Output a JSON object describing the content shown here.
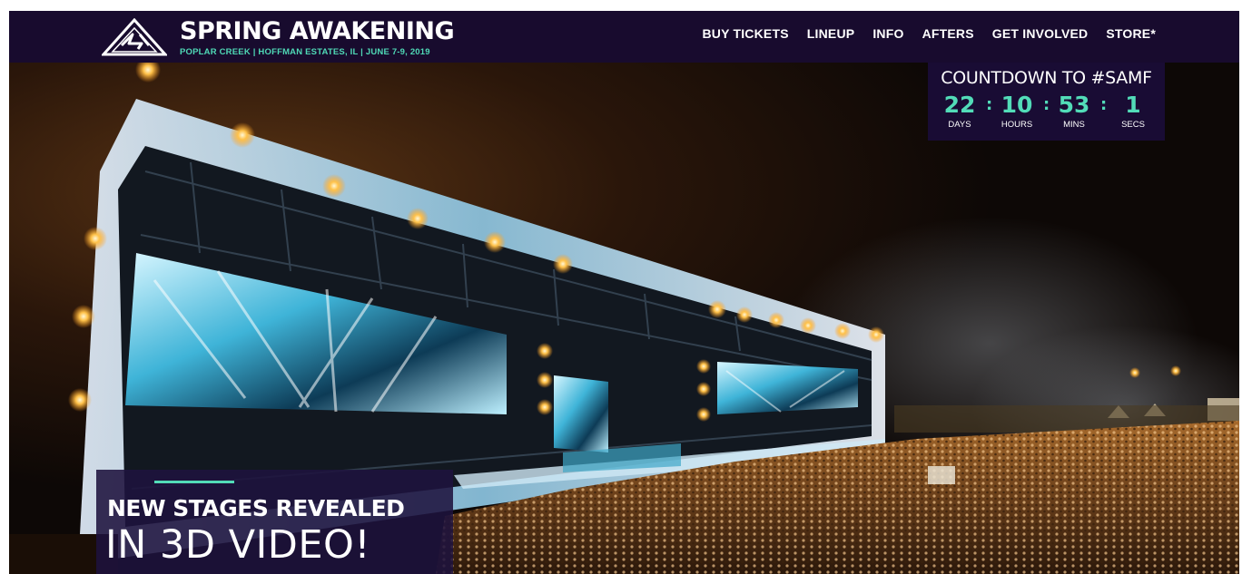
{
  "header": {
    "brand_title": "SPRING AWAKENING",
    "brand_subtitle": "POPLAR CREEK | HOFFMAN ESTATES, IL | JUNE 7-9, 2019",
    "logo_icon": "sa-triangle-logo-icon"
  },
  "nav": {
    "items": [
      "BUY TICKETS",
      "LINEUP",
      "INFO",
      "AFTERS",
      "GET INVOLVED",
      "STORE*"
    ]
  },
  "countdown": {
    "title": "COUNTDOWN TO #SAMF",
    "units": [
      {
        "value": "22",
        "label": "DAYS"
      },
      {
        "value": "10",
        "label": "HOURS"
      },
      {
        "value": "53",
        "label": "MINS"
      },
      {
        "value": "1",
        "label": "SECS"
      }
    ],
    "separator": ":"
  },
  "promo": {
    "line1": "NEW STAGES REVEALED",
    "line2": "IN 3D VIDEO!"
  },
  "colors": {
    "header_bg": "#180b2e",
    "accent": "#52dcb8",
    "promo_bg": "#1e123e"
  }
}
